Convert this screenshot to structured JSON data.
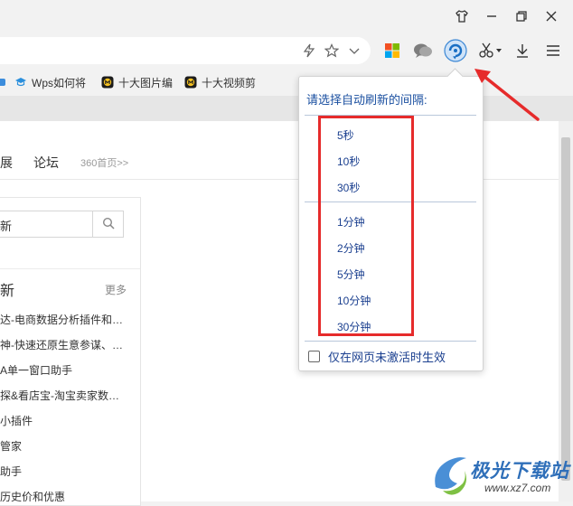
{
  "titlebar": {
    "icons": [
      "shirt-icon",
      "minimize-icon",
      "restore-icon",
      "close-icon"
    ]
  },
  "toolbar": {
    "icons": [
      "lightning-icon",
      "star-icon",
      "chevron-down-icon",
      "apps-grid-icon",
      "chat-bubbles-icon",
      "auto-refresh-icon",
      "scissors-icon",
      "download-icon",
      "menu-icon"
    ]
  },
  "bookmarks": [
    {
      "label": "Wps如何将",
      "icon": "graduation-cap-icon"
    },
    {
      "label": "十大图片编",
      "icon": "site-logo-icon"
    },
    {
      "label": "十大视频剪",
      "icon": "site-logo-icon"
    }
  ],
  "page": {
    "tabs": [
      {
        "label": "展"
      },
      {
        "label": "论坛"
      },
      {
        "label": "360首页>>"
      }
    ],
    "search_value": "新",
    "section_title": "新",
    "more_label": "更多",
    "list": [
      "达-电商数据分析插件和…",
      "神-快速还原生意参谋、…",
      "A单一窗口助手",
      "探&看店宝-淘宝卖家数…",
      "小插件",
      "管家",
      "助手",
      "历史价和优惠"
    ]
  },
  "popup": {
    "title": "请选择自动刷新的间隔:",
    "seconds": [
      "5秒",
      "10秒",
      "30秒"
    ],
    "minutes": [
      "1分钟",
      "2分钟",
      "5分钟",
      "10分钟",
      "30分钟"
    ],
    "checkbox_label": "仅在网页未激活时生效",
    "checkbox_checked": false
  },
  "watermark": {
    "text": "极光下载站",
    "url": "www.xz7.com"
  },
  "colors": {
    "accent_red": "#e62b2b",
    "popup_text": "#1a3f8f",
    "popup_title": "#1a4fa0"
  }
}
